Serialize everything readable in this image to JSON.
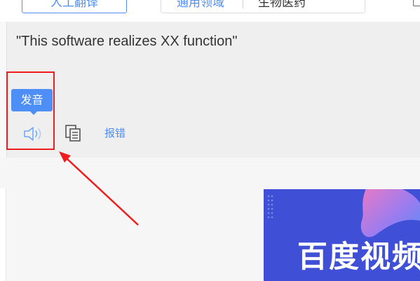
{
  "toolbar": {
    "human_translate_label": "人工翻译",
    "domain_general_label": "通用领域",
    "domain_specific_label": "生物医药"
  },
  "result": {
    "text": "\"This software realizes XX function\"",
    "tooltip_label": "发音",
    "speaker_icon": "speaker-icon",
    "copy_icon": "copy-icon",
    "report_error_label": "报错"
  },
  "ad": {
    "title": "百度视频"
  },
  "colors": {
    "accent": "#4e8ef7",
    "annotation": "#ee1c1c",
    "ad_background": "#3f4fd6"
  }
}
